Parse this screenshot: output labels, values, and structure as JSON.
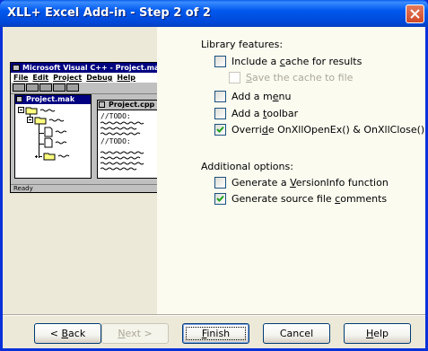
{
  "window": {
    "title": "XLL+ Excel Add-in - Step 2 of 2"
  },
  "illustration": {
    "app_title": "Microsoft Visual C++ - Project.mak",
    "menu": [
      "File",
      "Edit",
      "Project",
      "Debug",
      "Help"
    ],
    "project_window_title": "Project.mak",
    "source_window_title": "Project.cpp",
    "todo_1": "//TODO:",
    "todo_2": "//TODO:",
    "status": "Ready"
  },
  "library_features": {
    "label": "Library features:",
    "items": [
      {
        "pre": "Include a ",
        "key": "c",
        "post": "ache for results",
        "checked": false,
        "enabled": true
      },
      {
        "pre": "",
        "key": "S",
        "post": "ave the cache to file",
        "checked": false,
        "enabled": false
      },
      {
        "pre": "Add a m",
        "key": "e",
        "post": "nu",
        "checked": false,
        "enabled": true
      },
      {
        "pre": "Add a ",
        "key": "t",
        "post": "oolbar",
        "checked": false,
        "enabled": true
      },
      {
        "pre": "Overri",
        "key": "d",
        "post": "e OnXllOpenEx() & OnXllClose()",
        "checked": true,
        "enabled": true
      }
    ]
  },
  "additional_options": {
    "label": "Additional options:",
    "items": [
      {
        "pre": "Generate a ",
        "key": "V",
        "post": "ersionInfo function",
        "checked": false,
        "enabled": true
      },
      {
        "pre": "Generate source file ",
        "key": "c",
        "post": "omments",
        "checked": true,
        "enabled": true
      }
    ]
  },
  "buttons": {
    "back": {
      "pre": "< ",
      "key": "B",
      "post": "ack"
    },
    "next": {
      "pre": "",
      "key": "N",
      "post": "ext >"
    },
    "finish": {
      "pre": "",
      "key": "F",
      "post": "inish"
    },
    "cancel": {
      "pre": "",
      "key": "",
      "post": "Cancel"
    },
    "help": {
      "pre": "",
      "key": "H",
      "post": "elp"
    }
  },
  "colors": {
    "title_bar": "#0058ee",
    "dialog_face": "#ece9d8",
    "options_pane": "#fbfbf0",
    "close_button": "#d04a28"
  }
}
